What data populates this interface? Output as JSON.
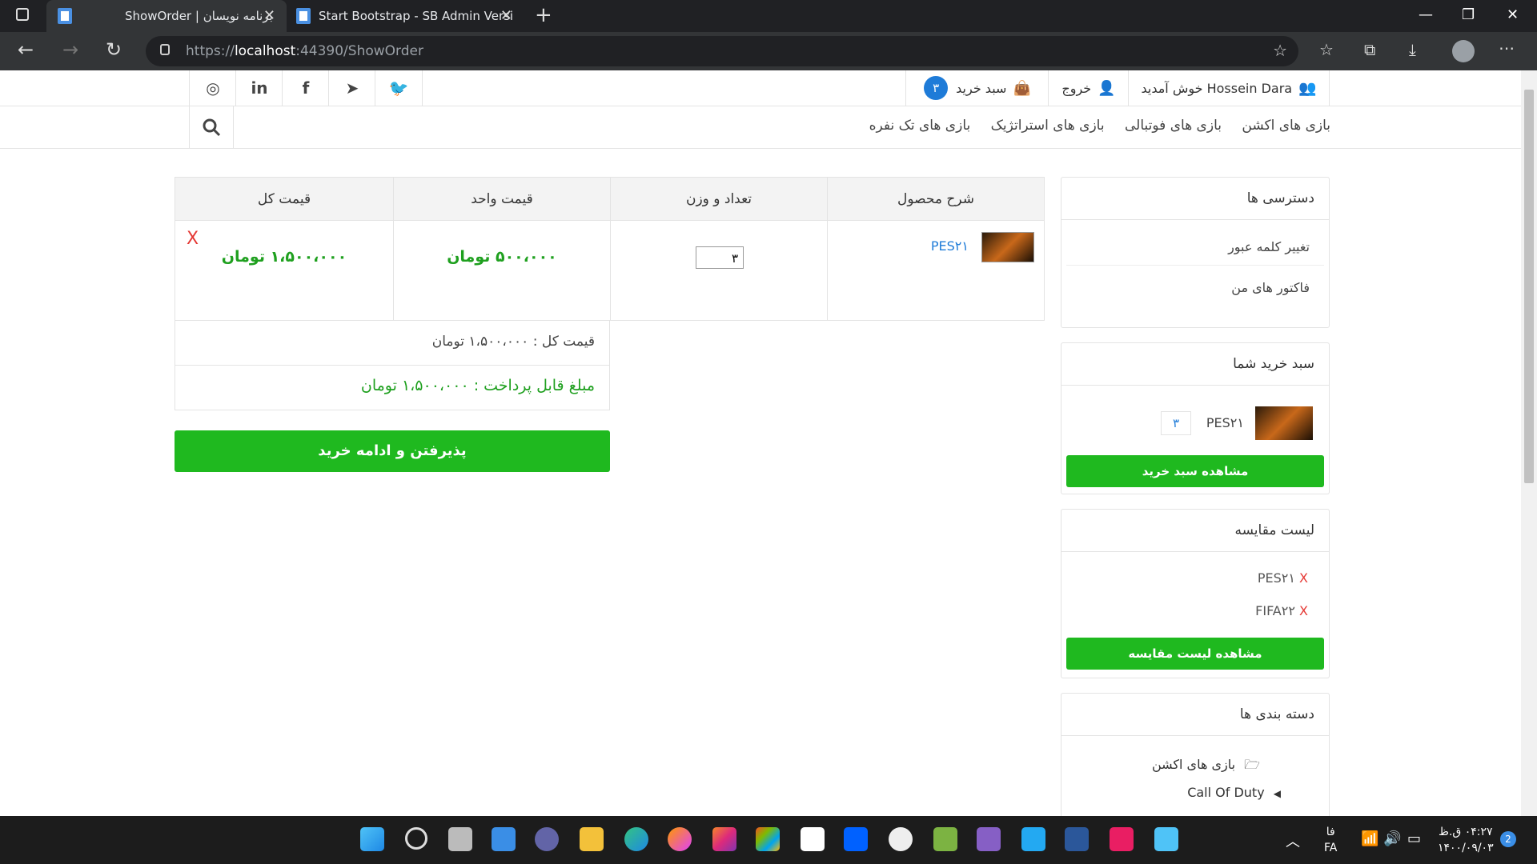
{
  "browser": {
    "tabs": [
      {
        "title": "ShowOrder | برنامه نویسان"
      },
      {
        "title": "Start Bootstrap - SB Admin Versi"
      }
    ],
    "url_scheme": "https://",
    "url_host": "localhost",
    "url_rest": ":44390/ShowOrder"
  },
  "header": {
    "welcome": "Hossein Dara خوش آمدید",
    "logout": "خروج",
    "cart_label": "سبد خرید",
    "cart_count": "۳"
  },
  "menu": {
    "items": [
      "بازی های اکشن",
      "بازی های فوتبالی",
      "بازی های استراتژیک",
      "بازی های تک نفره"
    ]
  },
  "order_table": {
    "headers": [
      "شرح محصول",
      "تعداد و وزن",
      "قیمت واحد",
      "قیمت کل"
    ],
    "row": {
      "product": "PES۲۱",
      "quantity": "۳",
      "unit_price": "۵۰۰،۰۰۰ تومان",
      "total_price": "۱،۵۰۰،۰۰۰ تومان",
      "remove": "X"
    },
    "total_line": "قیمت کل : ۱،۵۰۰،۰۰۰ تومان",
    "payable_line": "مبلغ قابل پرداخت : ۱،۵۰۰،۰۰۰ تومان",
    "checkout_button": "پذیرفتن و ادامه خرید"
  },
  "sidebar": {
    "access": {
      "title": "دسترسی ها",
      "items": [
        "تغییر کلمه عبور",
        "فاکتور های من"
      ]
    },
    "cart": {
      "title": "سبد خرید شما",
      "item_name": "PES۲۱",
      "item_qty": "۳",
      "button": "مشاهده سبد خرید"
    },
    "compare": {
      "title": "لیست مقایسه",
      "items": [
        "PES۲۱",
        "FIFA۲۲"
      ],
      "remove": "X",
      "button": "مشاهده لیست مقایسه"
    },
    "categories": {
      "title": "دسته بندی ها",
      "group": "بازی های اکشن",
      "sub": "Call Of Duty"
    }
  },
  "taskbar": {
    "lang_short": "فا",
    "lang": "FA",
    "time": "۰۴:۲۷ ق.ظ",
    "date": "۱۴۰۰/۰۹/۰۳",
    "notifications": "2"
  },
  "colors": {
    "accent_blue": "#1e7bd8",
    "green": "#1fb91f",
    "price_green": "#1fa01f",
    "remove_red": "#e53935"
  }
}
